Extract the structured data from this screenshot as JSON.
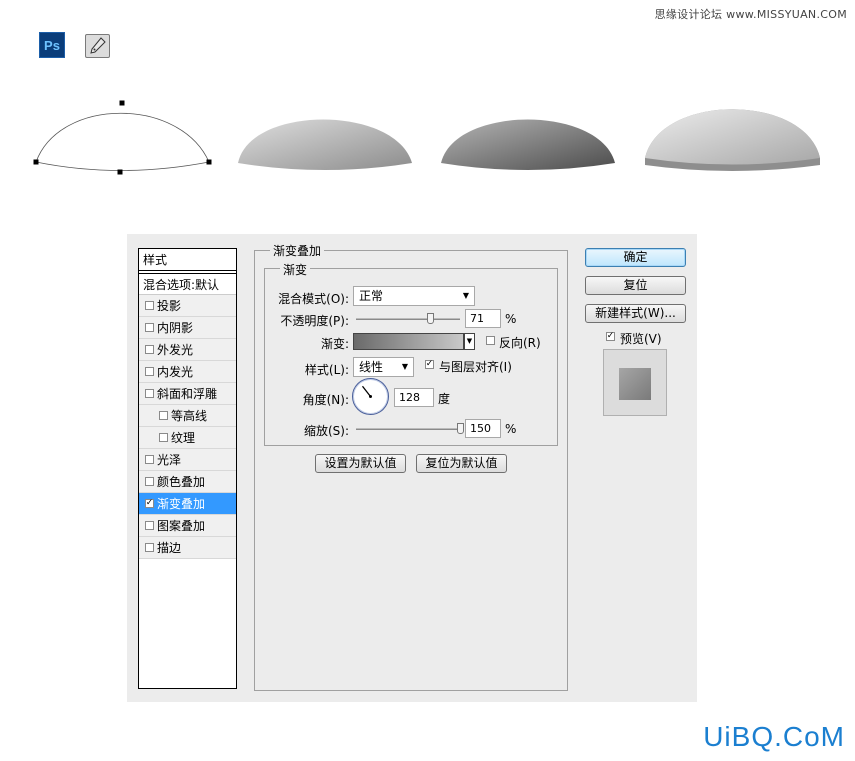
{
  "watermarks": {
    "top": "思缘设计论坛 www.MISSYUAN.COM",
    "bottom": "UiBQ.CoM"
  },
  "toolbar": {
    "ps_logo": "Ps",
    "pen_icon": "pen-tool-icon"
  },
  "dialog": {
    "style_list": {
      "header": "样式",
      "blend": "混合选项:默认",
      "items": [
        {
          "label": "投影",
          "checked": false
        },
        {
          "label": "内阴影",
          "checked": false
        },
        {
          "label": "外发光",
          "checked": false
        },
        {
          "label": "内发光",
          "checked": false
        },
        {
          "label": "斜面和浮雕",
          "checked": false
        },
        {
          "label": "等高线",
          "checked": false
        },
        {
          "label": "纹理",
          "checked": false
        },
        {
          "label": "光泽",
          "checked": false
        },
        {
          "label": "颜色叠加",
          "checked": false
        },
        {
          "label": "渐变叠加",
          "checked": true
        },
        {
          "label": "图案叠加",
          "checked": false
        },
        {
          "label": "描边",
          "checked": false
        }
      ]
    },
    "panel": {
      "title": "渐变叠加",
      "subtitle": "渐变",
      "blend_mode_label": "混合模式(O):",
      "blend_mode_value": "正常",
      "opacity_label": "不透明度(P):",
      "opacity_value": "71",
      "opacity_unit": "%",
      "opacity_fraction": 0.71,
      "gradient_label": "渐变:",
      "reverse_label": "反向(R)",
      "reverse_checked": false,
      "style_label": "样式(L):",
      "style_value": "线性",
      "align_label": "与图层对齐(I)",
      "align_checked": true,
      "angle_label": "角度(N):",
      "angle_value": "128",
      "angle_unit": "度",
      "scale_label": "缩放(S):",
      "scale_value": "150",
      "scale_unit": "%",
      "scale_fraction": 1.0,
      "set_default_button": "设置为默认值",
      "reset_default_button": "复位为默认值"
    },
    "buttons": {
      "ok": "确定",
      "reset": "复位",
      "new_style": "新建样式(W)...",
      "preview_label": "预览(V)",
      "preview_checked": true
    }
  }
}
